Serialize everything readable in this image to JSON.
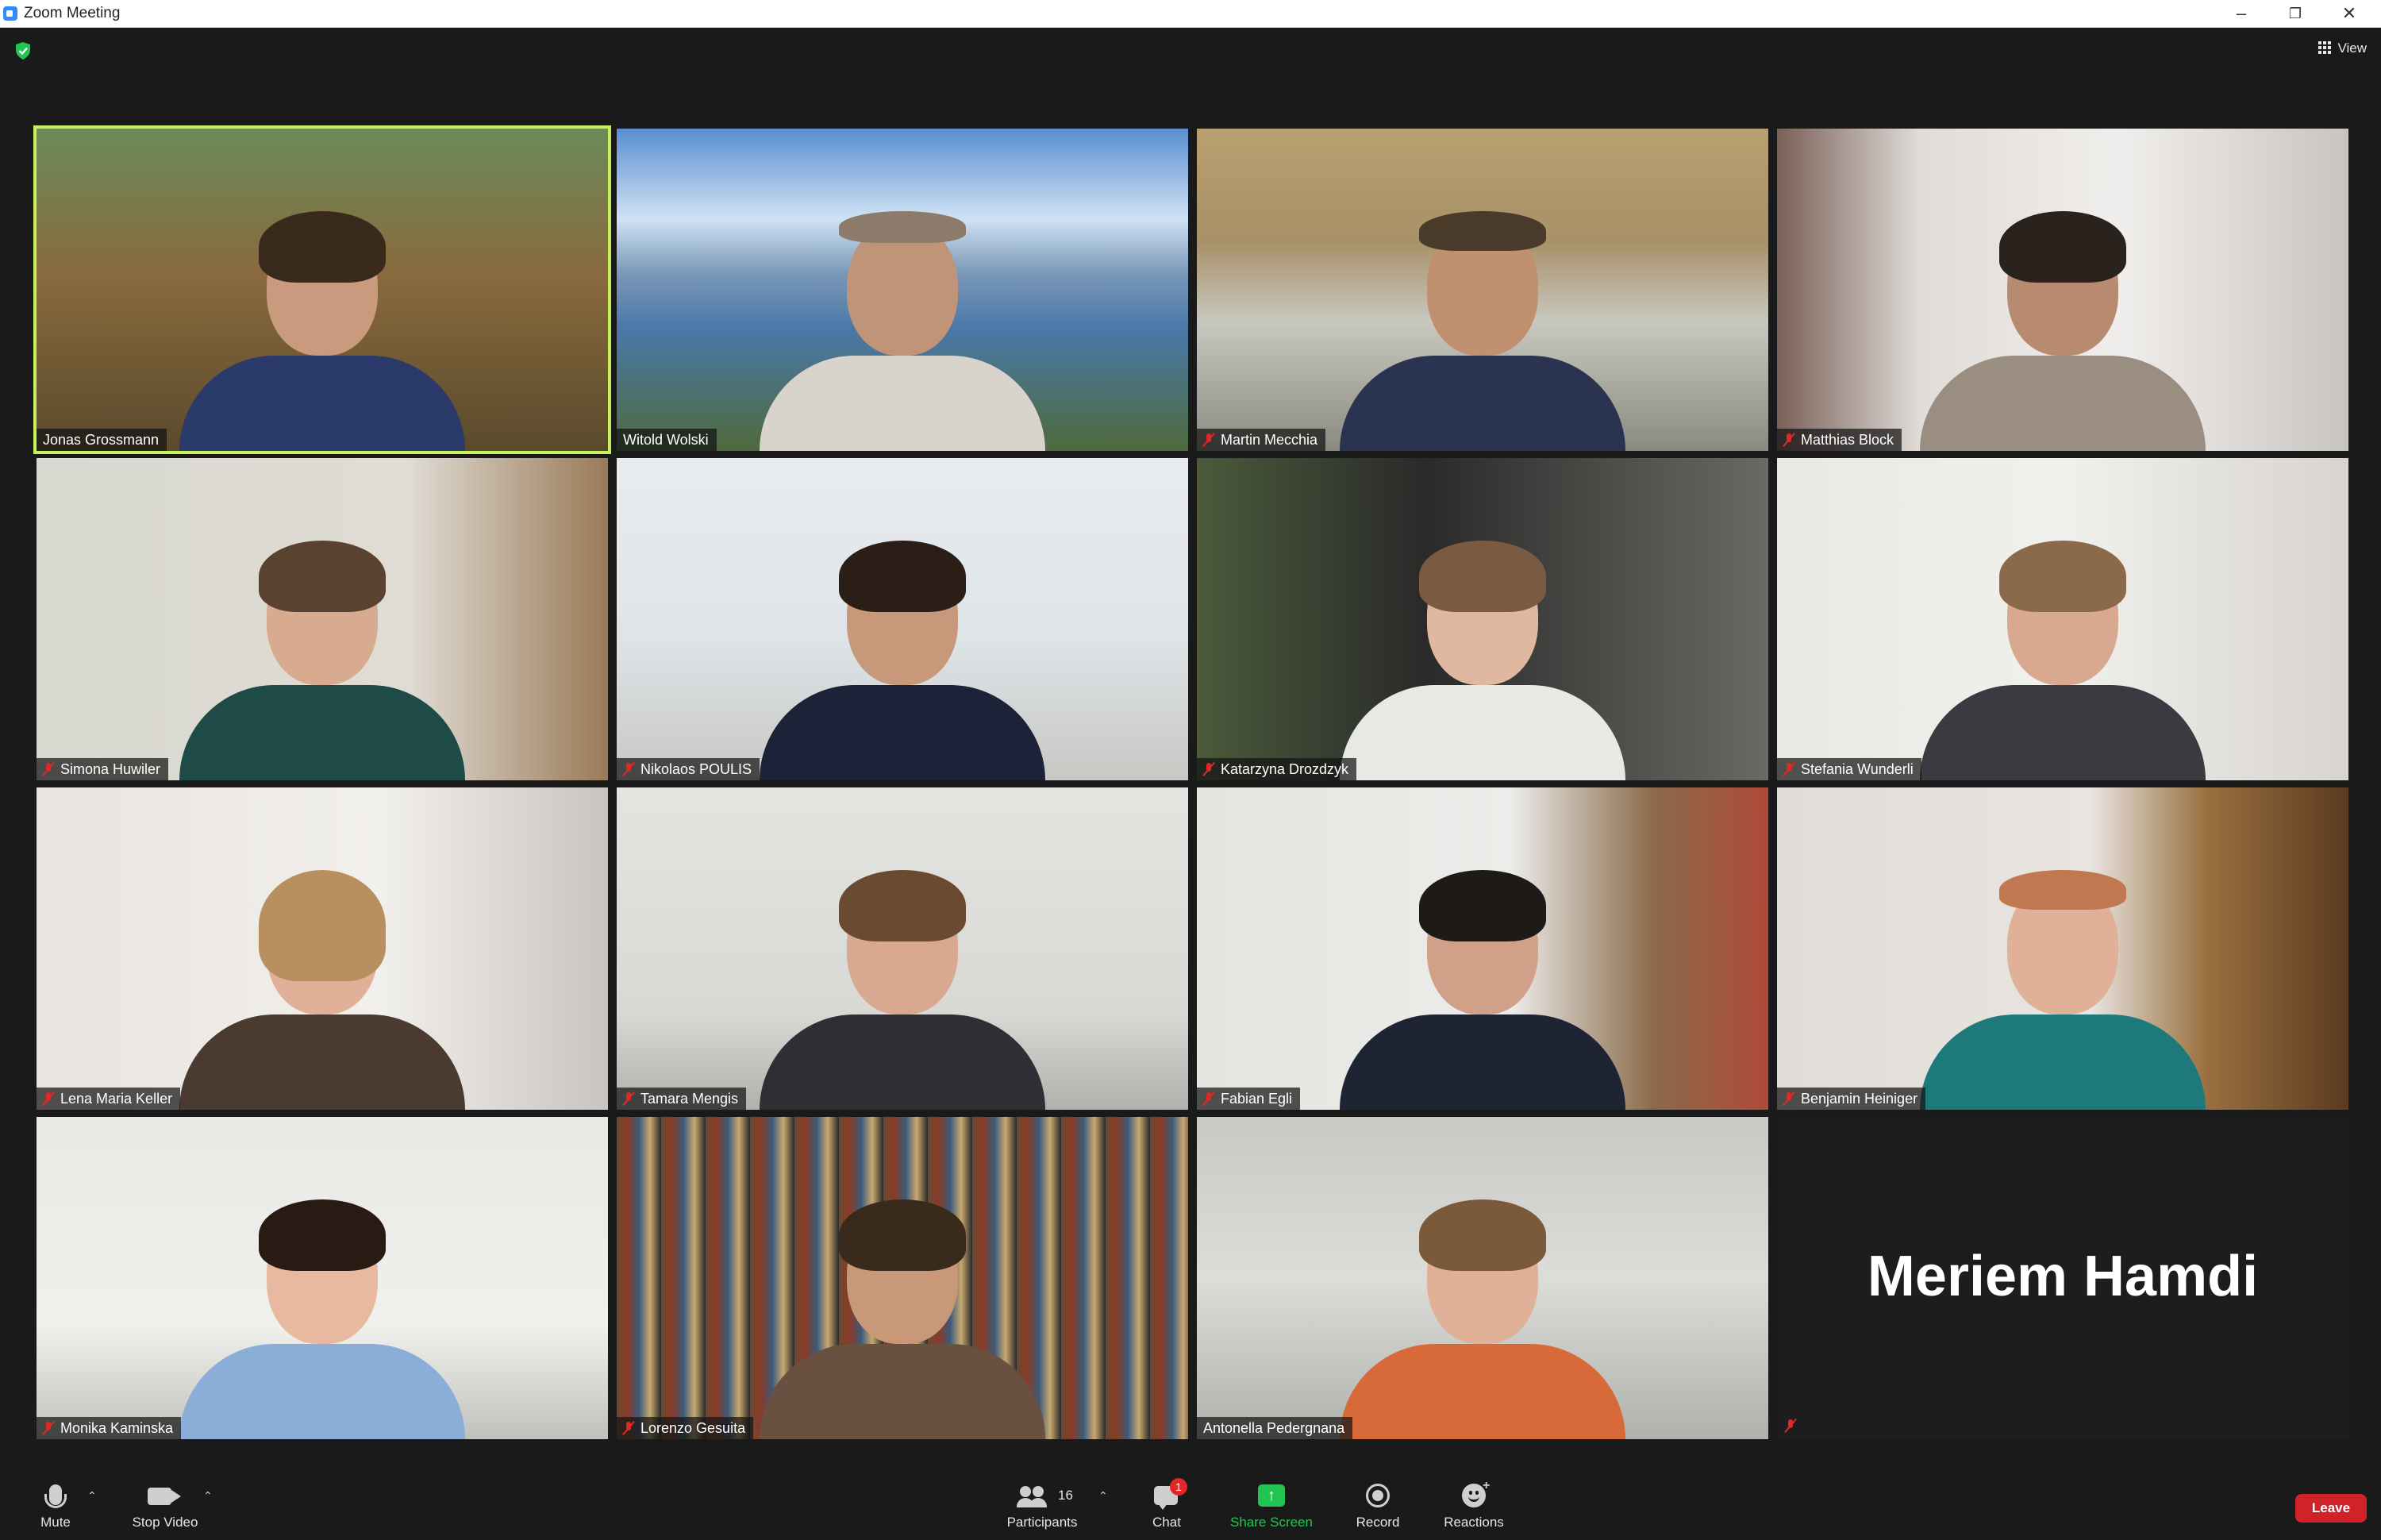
{
  "window": {
    "title": "Zoom Meeting",
    "controls": [
      "minimize-icon",
      "restore-icon",
      "close-icon"
    ]
  },
  "header": {
    "security_icon": "shield-check-icon",
    "security_color": "#23c552",
    "view_label": "View"
  },
  "active_speaker_color": "#c8f05a",
  "participants": [
    {
      "name": "Jonas Grossmann",
      "muted": false,
      "active": true
    },
    {
      "name": "Witold Wolski",
      "muted": false,
      "active": false
    },
    {
      "name": "Martin Mecchia",
      "muted": true,
      "active": false
    },
    {
      "name": "Matthias Block",
      "muted": true,
      "active": false
    },
    {
      "name": "Simona Huwiler",
      "muted": true,
      "active": false
    },
    {
      "name": "Nikolaos POULIS",
      "muted": true,
      "active": false
    },
    {
      "name": "Katarzyna Drozdzyk",
      "muted": true,
      "active": false
    },
    {
      "name": "Stefania Wunderli",
      "muted": true,
      "active": false
    },
    {
      "name": "Lena Maria Keller",
      "muted": true,
      "active": false
    },
    {
      "name": "Tamara Mengis",
      "muted": true,
      "active": false
    },
    {
      "name": "Fabian Egli",
      "muted": true,
      "active": false
    },
    {
      "name": "Benjamin Heiniger",
      "muted": true,
      "active": false
    },
    {
      "name": "Monika Kaminska",
      "muted": true,
      "active": false
    },
    {
      "name": "Lorenzo Gesuita",
      "muted": true,
      "active": false
    },
    {
      "name": "Antonella Pedergnana",
      "muted": false,
      "active": false
    },
    {
      "name": "Meriem Hamdi",
      "muted": true,
      "active": false,
      "video_off": true
    }
  ],
  "toolbar": {
    "mute_label": "Mute",
    "stop_video_label": "Stop Video",
    "participants_label": "Participants",
    "participants_count": "16",
    "chat_label": "Chat",
    "chat_badge": "1",
    "share_screen_label": "Share Screen",
    "record_label": "Record",
    "reactions_label": "Reactions",
    "leave_label": "Leave",
    "share_color": "#23c552",
    "leave_color": "#d1222a"
  }
}
